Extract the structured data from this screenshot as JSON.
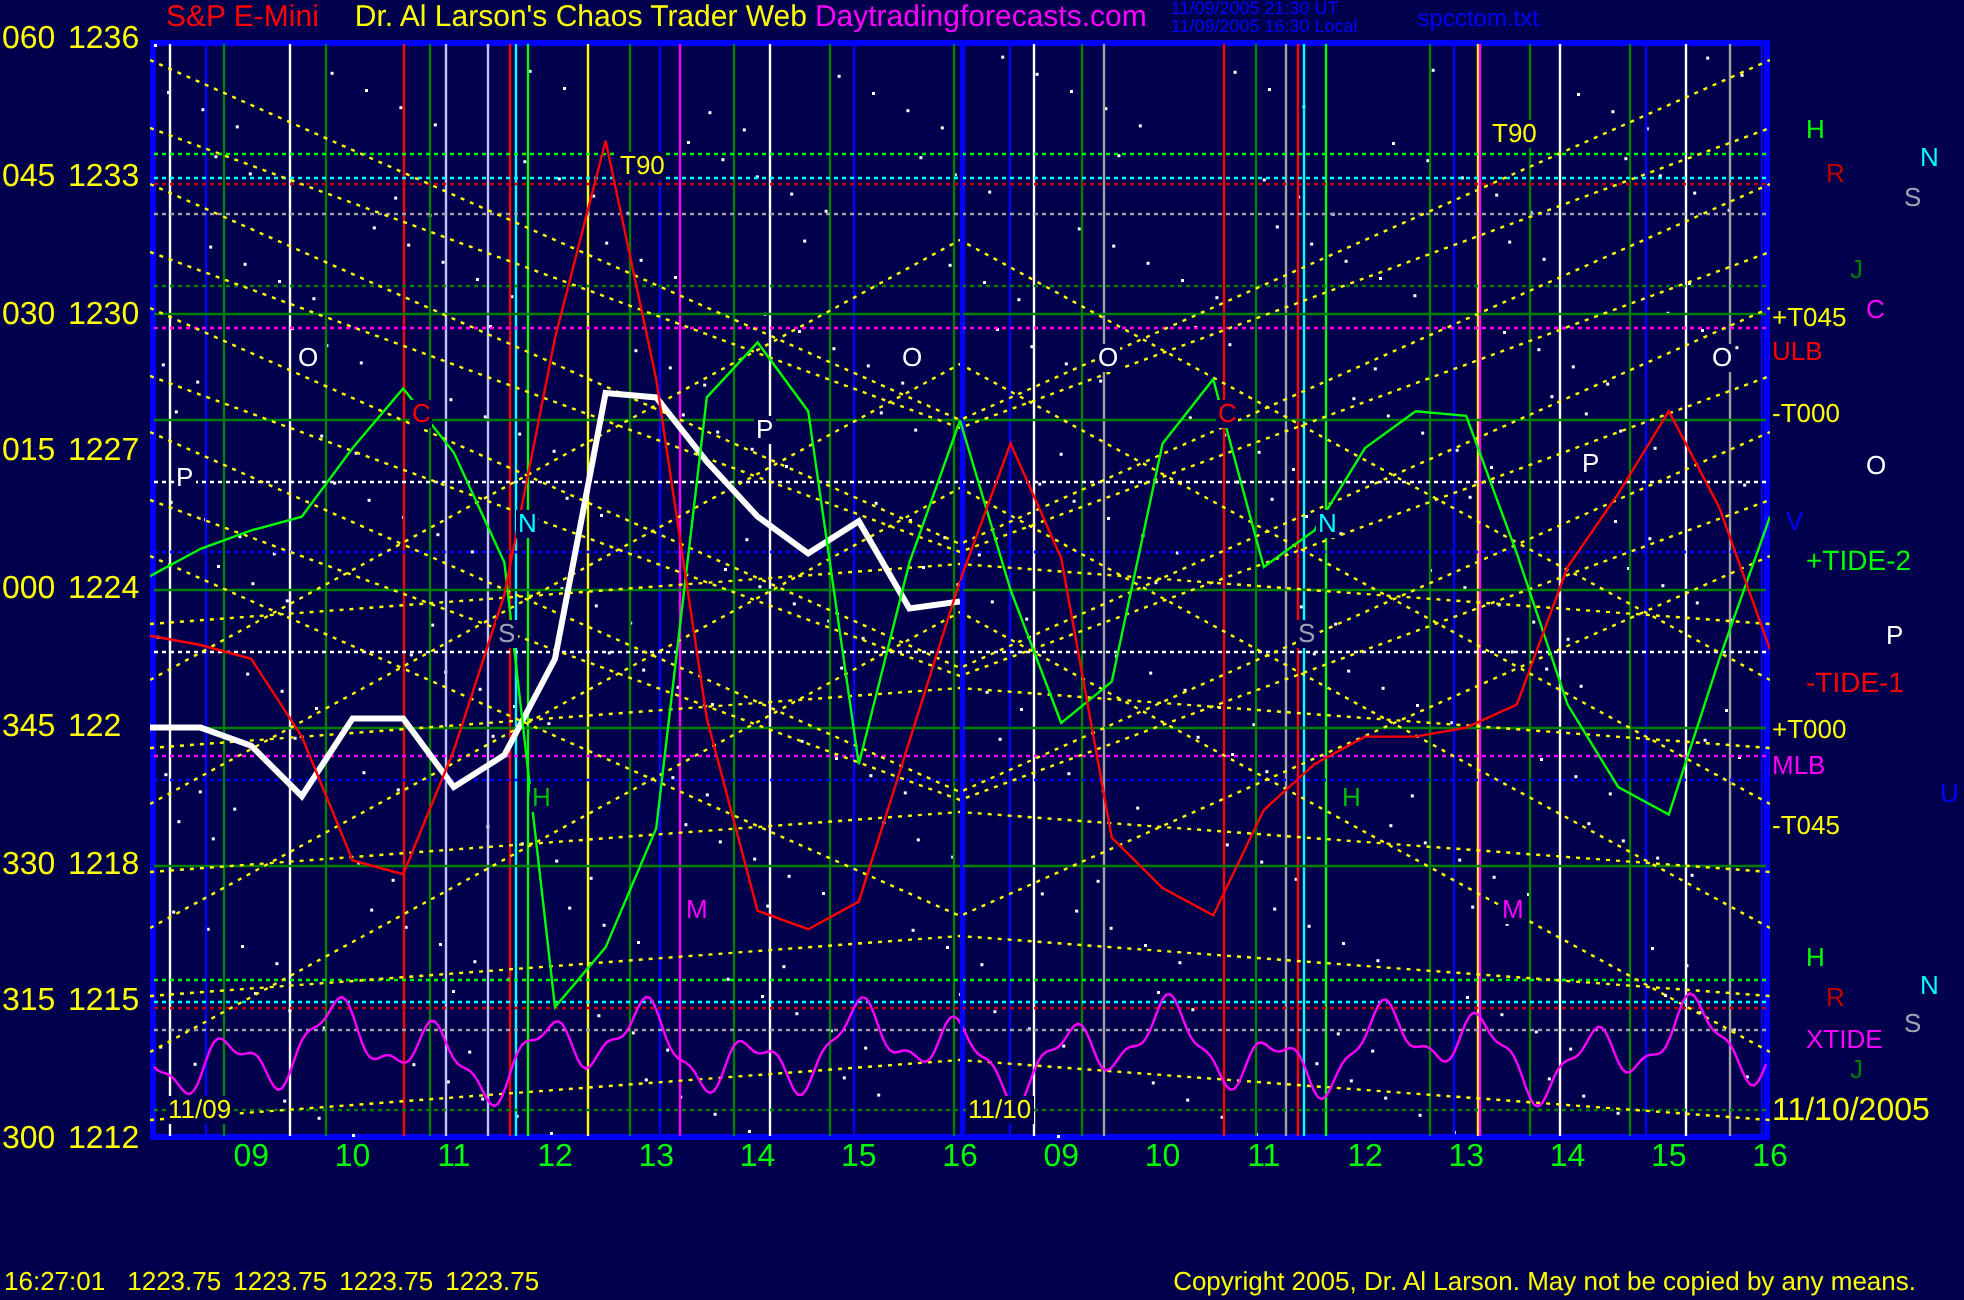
{
  "header": {
    "title": "Dr. Al Larson's Chaos Trader Web",
    "site": "Daytradingforecasts.com",
    "time_ut": "11/09/2005 21:30 UT",
    "time_local": "11/09/2005 16:30 Local",
    "file": "spcctom.txt"
  },
  "y_axis": {
    "angles": [
      "060",
      "045",
      "030",
      "015",
      "000",
      "345",
      "330",
      "315",
      "300"
    ],
    "partial_label": "122"
  },
  "day_one": {
    "chart_data": {
      "type": "line",
      "xlim": [
        8,
        16
      ],
      "ylim": [
        1212,
        1236
      ],
      "x": [
        8,
        8.5,
        9,
        9.5,
        10,
        10.5,
        11,
        11.5,
        12,
        12.5,
        13,
        13.5,
        14,
        14.5,
        15,
        15.5,
        16
      ],
      "series": [
        {
          "name": "S&P E-Mini",
          "color": "#ffffff",
          "values": [
            1221,
            1221,
            1220.6,
            1219.5,
            1221.2,
            1221.2,
            1219.7,
            1220.4,
            1222.5,
            1228.3,
            1228.2,
            1226.8,
            1225.6,
            1224.8,
            1225.5,
            1223.6,
            1223.75
          ]
        },
        {
          "color": "#00ff00",
          "values": [
            1224.3,
            1224.9,
            1225.3,
            1225.6,
            1227.1,
            1228.4,
            1227.0,
            1224.6,
            1214.9,
            1216.2,
            1218.8,
            1228.2,
            1229.4,
            1227.9,
            1220.2,
            1224.6,
            1227.7
          ]
        },
        {
          "color": "#ff0000",
          "values": [
            1223.0,
            1222.8,
            1222.5,
            1220.8,
            1218.1,
            1217.8,
            1220.5,
            1223.9,
            1229.5,
            1233.8,
            1228.6,
            1221.2,
            1217.0,
            1216.6,
            1217.2,
            1220.7,
            1224.2
          ]
        }
      ],
      "yticks": [
        {
          "value": 1236,
          "label": "1236"
        },
        {
          "value": 1233,
          "label": "1233"
        },
        {
          "value": 1230,
          "label": "1230"
        },
        {
          "value": 1227,
          "label": "1227"
        },
        {
          "value": 1224,
          "label": "1224"
        },
        {
          "value": 1218,
          "label": "1218"
        },
        {
          "value": 1215,
          "label": "1215"
        },
        {
          "value": 1212,
          "label": "1212"
        }
      ],
      "xticks": [
        {
          "value": 9,
          "label": "09"
        },
        {
          "value": 10,
          "label": "10"
        },
        {
          "value": 11,
          "label": "11"
        },
        {
          "value": 12,
          "label": "12"
        },
        {
          "value": 13,
          "label": "13"
        },
        {
          "value": 14,
          "label": "14"
        },
        {
          "value": 15,
          "label": "15"
        },
        {
          "value": 16,
          "label": "16"
        }
      ]
    }
  },
  "day_two": {
    "chart_data": {
      "type": "line",
      "xlim": [
        8,
        16
      ],
      "ylim": [
        1212,
        1236
      ],
      "x": [
        8,
        8.5,
        9,
        9.5,
        10,
        10.5,
        11,
        11.5,
        12,
        12.5,
        13,
        13.5,
        14,
        14.5,
        15,
        15.5,
        16
      ],
      "series": [
        {
          "name": "+TIDE-2",
          "color": "#00ff00",
          "values": [
            1227.7,
            1224.0,
            1221.1,
            1222.0,
            1227.2,
            1228.6,
            1224.5,
            1225.3,
            1227.1,
            1227.9,
            1227.8,
            1224.8,
            1221.5,
            1219.7,
            1219.1,
            1222.5,
            1225.6
          ]
        },
        {
          "name": "-TIDE-1",
          "color": "#ff0000",
          "values": [
            1224.2,
            1227.2,
            1224.7,
            1218.6,
            1217.5,
            1216.9,
            1219.2,
            1220.2,
            1220.8,
            1220.8,
            1221.0,
            1221.5,
            1224.5,
            1226.1,
            1227.9,
            1225.8,
            1222.7
          ]
        }
      ],
      "xticks": [
        {
          "value": 9,
          "label": "09"
        },
        {
          "value": 10,
          "label": "10"
        },
        {
          "value": 11,
          "label": "11"
        },
        {
          "value": 12,
          "label": "12"
        },
        {
          "value": 13,
          "label": "13"
        },
        {
          "value": 14,
          "label": "14"
        },
        {
          "value": 15,
          "label": "15"
        },
        {
          "value": 16,
          "label": "16"
        }
      ]
    }
  },
  "chart_labels": [
    {
      "text": "T90",
      "color": "#ffff00"
    },
    {
      "text": "T90",
      "color": "#ffff00"
    },
    {
      "text": "O",
      "color": "#ffffff"
    },
    {
      "text": "O",
      "color": "#ffffff"
    },
    {
      "text": "O",
      "color": "#ffffff"
    },
    {
      "text": "O",
      "color": "#ffffff"
    },
    {
      "text": "C",
      "color": "#ff0000"
    },
    {
      "text": "C",
      "color": "#ff0000"
    },
    {
      "text": "P",
      "color": "#ffffff"
    },
    {
      "text": "P",
      "color": "#ffffff"
    },
    {
      "text": "P",
      "color": "#ffffff"
    },
    {
      "text": "N",
      "color": "#00ffff"
    },
    {
      "text": "N",
      "color": "#00ffff"
    },
    {
      "text": "S",
      "color": "#a0a0b0"
    },
    {
      "text": "S",
      "color": "#a0a0b0"
    },
    {
      "text": "H",
      "color": "#00c000"
    },
    {
      "text": "H",
      "color": "#00c000"
    },
    {
      "text": "M",
      "color": "#ff00ff"
    },
    {
      "text": "M",
      "color": "#ff00ff"
    },
    {
      "text": "11/09",
      "color": "#ffff00"
    },
    {
      "text": "11/10",
      "color": "#ffff00"
    }
  ],
  "legend": [
    {
      "text": "H",
      "color": "#00ff00"
    },
    {
      "text": "R",
      "color": "#c00000"
    },
    {
      "text": "N",
      "color": "#00ffff"
    },
    {
      "text": "S",
      "color": "#a0a0b0"
    },
    {
      "text": "J",
      "color": "#008000"
    },
    {
      "text": "C",
      "color": "#ff00ff"
    },
    {
      "text": "+T045",
      "color": "#ffff00"
    },
    {
      "text": "ULB",
      "color": "#ff0000"
    },
    {
      "text": "-T000",
      "color": "#ffff00"
    },
    {
      "text": "O",
      "color": "#ffffff"
    },
    {
      "text": "V",
      "color": "#0000ff"
    },
    {
      "text": "P",
      "color": "#ffffff"
    },
    {
      "text": "+T000",
      "color": "#ffff00"
    },
    {
      "text": "MLB",
      "color": "#ff00ff"
    },
    {
      "text": "U",
      "color": "#0000ff"
    },
    {
      "text": "-T045",
      "color": "#ffff00"
    },
    {
      "text": "H",
      "color": "#00ff00"
    },
    {
      "text": "R",
      "color": "#c00000"
    },
    {
      "text": "N",
      "color": "#00ffff"
    },
    {
      "text": "S",
      "color": "#a0a0b0"
    },
    {
      "text": "XTIDE",
      "color": "#ff00ff"
    },
    {
      "text": "J",
      "color": "#008000"
    },
    {
      "text": "11/10/2005",
      "color": "#ffff00"
    }
  ],
  "footer": {
    "time": "16:27:01",
    "prices": [
      "1223.75",
      "1223.75",
      "1223.75",
      "1223.75"
    ],
    "copyright": "Copyright 2005, Dr. Al Larson. May not be copied by any means."
  }
}
